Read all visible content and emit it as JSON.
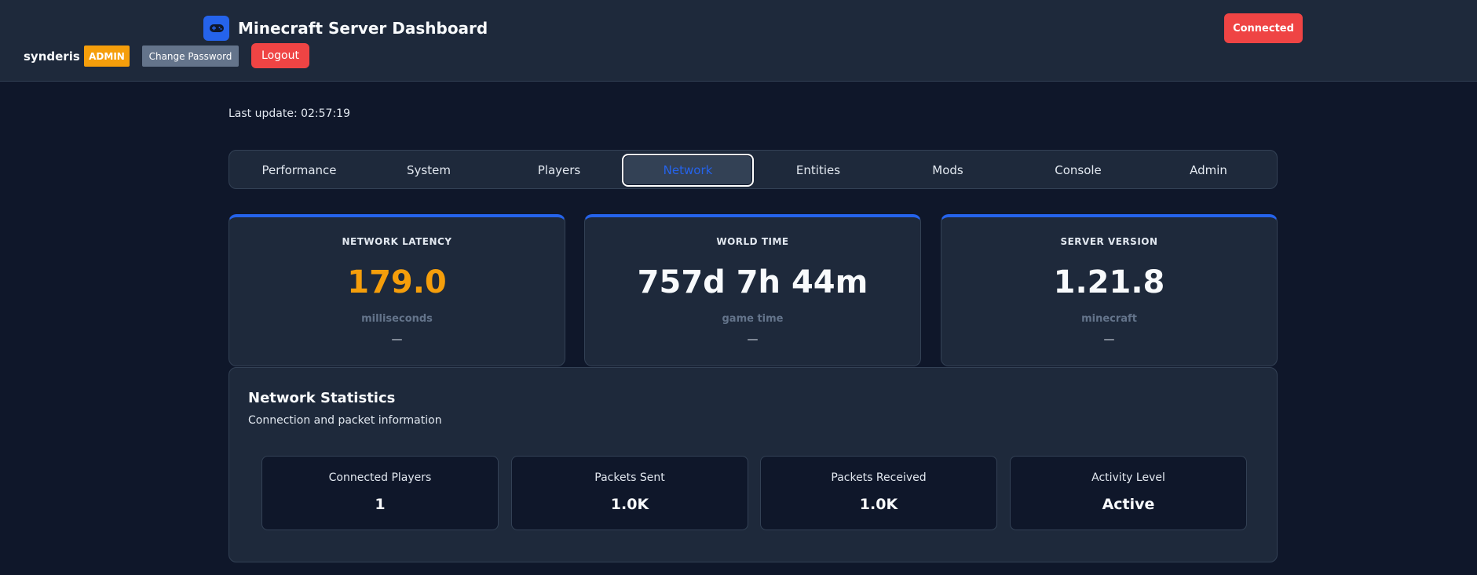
{
  "header": {
    "app_title": "Minecraft Server Dashboard",
    "app_icon": "gamepad-icon",
    "username": "synderis",
    "role_badge": "ADMIN",
    "change_password_label": "Change Password",
    "logout_label": "Logout",
    "connection_status": "Connected"
  },
  "last_update": "Last update: 02:57:19",
  "tabs": [
    {
      "label": "Performance",
      "active": false
    },
    {
      "label": "System",
      "active": false
    },
    {
      "label": "Players",
      "active": false
    },
    {
      "label": "Network",
      "active": true
    },
    {
      "label": "Entities",
      "active": false
    },
    {
      "label": "Mods",
      "active": false
    },
    {
      "label": "Console",
      "active": false
    },
    {
      "label": "Admin",
      "active": false
    }
  ],
  "cards": [
    {
      "label": "NETWORK LATENCY",
      "value": "179.0",
      "unit": "milliseconds",
      "trend": "—"
    },
    {
      "label": "WORLD TIME",
      "value": "757d 7h 44m",
      "unit": "game time",
      "trend": "—"
    },
    {
      "label": "SERVER VERSION",
      "value": "1.21.8",
      "unit": "minecraft",
      "trend": "—"
    }
  ],
  "network_stats": {
    "title": "Network Statistics",
    "subtitle": "Connection and packet information",
    "items": [
      {
        "label": "Connected Players",
        "value": "1"
      },
      {
        "label": "Packets Sent",
        "value": "1.0K"
      },
      {
        "label": "Packets Received",
        "value": "1.0K"
      },
      {
        "label": "Activity Level",
        "value": "Active"
      }
    ]
  },
  "colors": {
    "background": "#0f172a",
    "panel": "#1e293b",
    "accent": "#2563eb",
    "warning": "#f59e0b",
    "danger": "#ef4444"
  }
}
